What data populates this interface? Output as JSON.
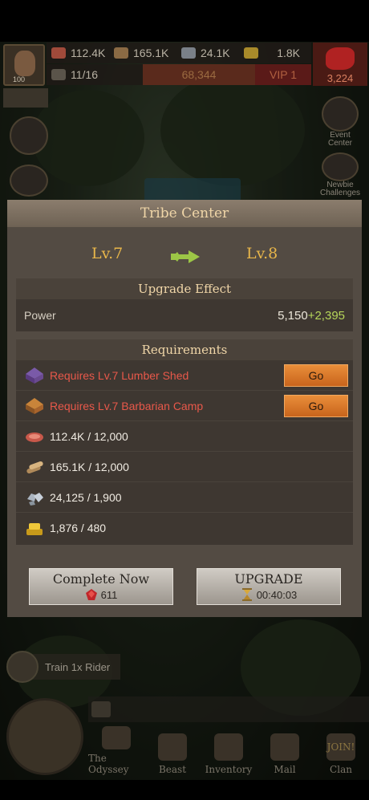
{
  "hud": {
    "player_level": "100",
    "meat": "112.4K",
    "wood": "165.1K",
    "stone": "24.1K",
    "gold": "1.8K",
    "troops": "11/16",
    "power": "68,344",
    "vip": "VIP 1",
    "gems": "3,224"
  },
  "side": {
    "event_center": "Event Center",
    "newbie_challenges": "Newbie Challenges"
  },
  "modal": {
    "title": "Tribe Center",
    "level_from": "Lv.7",
    "level_to": "Lv.8",
    "effect_header": "Upgrade Effect",
    "effect_label": "Power",
    "effect_base": "5,150",
    "effect_add": "+2,395",
    "req_header": "Requirements",
    "requirements": [
      {
        "text": "Requires Lv.7 Lumber Shed",
        "icon": "lumber-shed-icon",
        "go": "Go"
      },
      {
        "text": "Requires Lv.7 Barbarian Camp",
        "icon": "barbarian-camp-icon",
        "go": "Go"
      },
      {
        "text": "112.4K / 12,000",
        "icon": "meat-icon"
      },
      {
        "text": "165.1K / 12,000",
        "icon": "wood-icon"
      },
      {
        "text": "24,125 / 1,900",
        "icon": "stone-icon"
      },
      {
        "text": "1,876 / 480",
        "icon": "gold-icon"
      }
    ],
    "complete_label": "Complete Now",
    "complete_cost": "611",
    "upgrade_label": "UPGRADE",
    "upgrade_time": "00:40:03"
  },
  "task": {
    "label": "Train 1x Rider"
  },
  "nav": {
    "items": [
      "The Odyssey",
      "Beast",
      "Inventory",
      "Mail",
      "Clan"
    ],
    "join": "JOIN!"
  },
  "colors": {
    "modal_bg": "#534b43",
    "title": "#f0d6a8",
    "level": "#e8b64a",
    "warn": "#e8584a",
    "bonus": "#b6d65a",
    "go_button": "#e98e3a"
  }
}
